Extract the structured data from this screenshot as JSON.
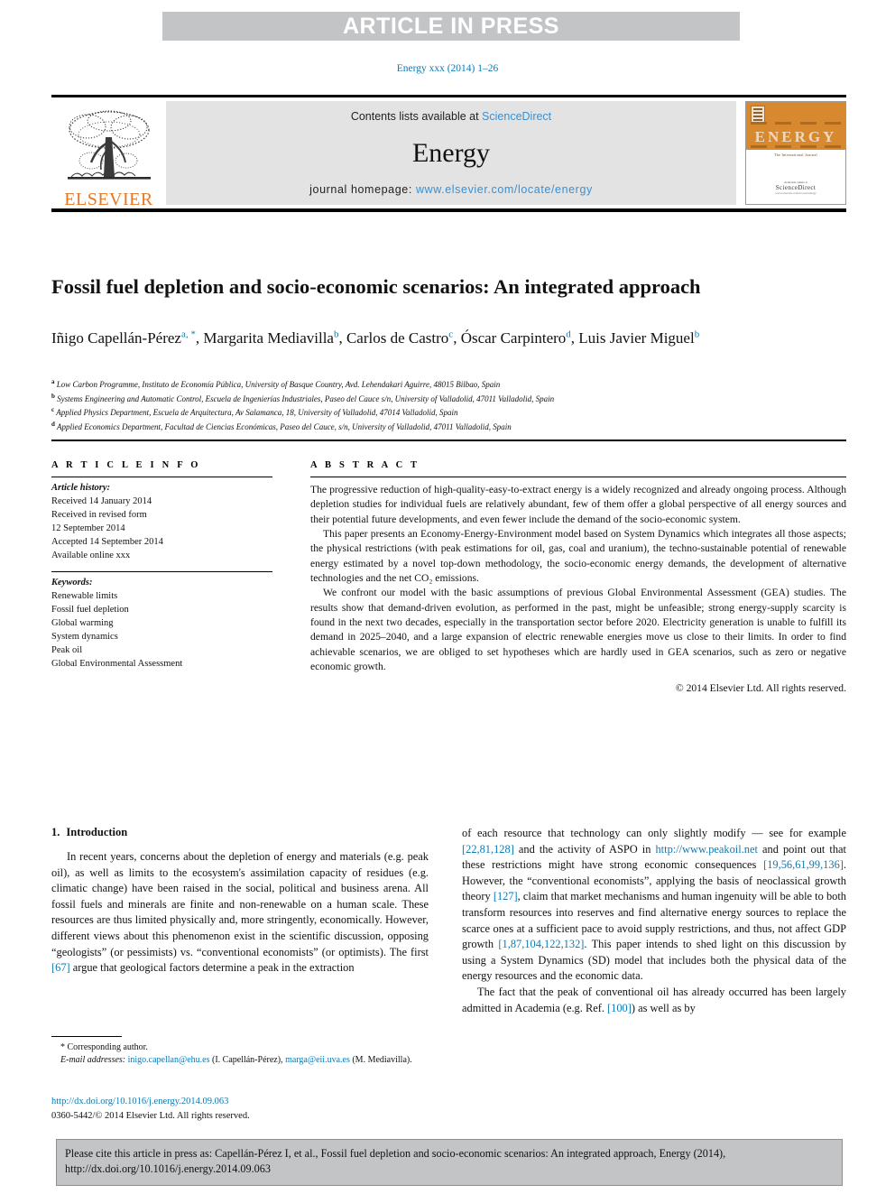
{
  "banner": {
    "label": "ARTICLE IN PRESS"
  },
  "journal_ref": "Energy xxx (2014) 1–26",
  "masthead": {
    "publisher": "ELSEVIER",
    "contents_prefix": "Contents lists available at ",
    "contents_link": "ScienceDirect",
    "journal_name": "Energy",
    "homepage_prefix": "journal homepage: ",
    "homepage_url": "www.elsevier.com/locate/energy",
    "cover": {
      "title": "ENERGY",
      "subtitle": "The International Journal",
      "footer_top": "Available online at",
      "footer_mid": "ScienceDirect",
      "footer_bottom": "www.elsevier.com/locate/energy"
    }
  },
  "article": {
    "title": "Fossil fuel depletion and socio-economic scenarios: An integrated approach",
    "authors": [
      {
        "name": "Iñigo Capellán-Pérez",
        "marks": "a, *"
      },
      {
        "name": "Margarita Mediavilla",
        "marks": "b"
      },
      {
        "name": "Carlos de Castro",
        "marks": "c"
      },
      {
        "name": "Óscar Carpintero",
        "marks": "d"
      },
      {
        "name": "Luis Javier Miguel",
        "marks": "b"
      }
    ],
    "affiliations": [
      {
        "mark": "a",
        "text": "Low Carbon Programme, Instituto de Economía Pública, University of Basque Country, Avd. Lehendakari Aguirre, 48015 Bilbao, Spain"
      },
      {
        "mark": "b",
        "text": "Systems Engineering and Automatic Control, Escuela de Ingenierías Industriales, Paseo del Cauce s/n, University of Valladolid, 47011 Valladolid, Spain"
      },
      {
        "mark": "c",
        "text": "Applied Physics Department, Escuela de Arquitectura, Av Salamanca, 18, University of Valladolid, 47014 Valladolid, Spain"
      },
      {
        "mark": "d",
        "text": "Applied Economics Department, Facultad de Ciencias Económicas, Paseo del Cauce, s/n, University of Valladolid, 47011 Valladolid, Spain"
      }
    ]
  },
  "info": {
    "heading": "A R T I C L E   I N F O",
    "history_label": "Article history:",
    "history": [
      "Received 14 January 2014",
      "Received in revised form",
      "12 September 2014",
      "Accepted 14 September 2014",
      "Available online xxx"
    ],
    "keywords_label": "Keywords:",
    "keywords": [
      "Renewable limits",
      "Fossil fuel depletion",
      "Global warming",
      "System dynamics",
      "Peak oil",
      "Global Environmental Assessment"
    ]
  },
  "abstract": {
    "heading": "A B S T R A C T",
    "paragraphs": [
      "The progressive reduction of high-quality-easy-to-extract energy is a widely recognized and already ongoing process. Although depletion studies for individual fuels are relatively abundant, few of them offer a global perspective of all energy sources and their potential future developments, and even fewer include the demand of the socio-economic system.",
      "This paper presents an Economy-Energy-Environment model based on System Dynamics which integrates all those aspects; the physical restrictions (with peak estimations for oil, gas, coal and uranium), the techno-sustainable potential of renewable energy estimated by a novel top-down methodology, the socio-economic energy demands, the development of alternative technologies and the net CO₂ emissions.",
      "We confront our model with the basic assumptions of previous Global Environmental Assessment (GEA) studies. The results show that demand-driven evolution, as performed in the past, might be unfeasible; strong energy-supply scarcity is found in the next two decades, especially in the transportation sector before 2020. Electricity generation is unable to fulfill its demand in 2025–2040, and a large expansion of electric renewable energies move us close to their limits. In order to find achievable scenarios, we are obliged to set hypotheses which are hardly used in GEA scenarios, such as zero or negative economic growth."
    ],
    "copyright": "© 2014 Elsevier Ltd. All rights reserved."
  },
  "intro": {
    "number": "1.",
    "heading": "Introduction",
    "left_paragraph": "In recent years, concerns about the depletion of energy and materials (e.g. peak oil), as well as limits to the ecosystem's assimilation capacity of residues (e.g. climatic change) have been raised in the social, political and business arena. All fossil fuels and minerals are finite and non-renewable on a human scale. These resources are thus limited physically and, more stringently, economically. However, different views about this phenomenon exist in the scientific discussion, opposing “geologists” (or pessimists) vs. “conventional economists” (or optimists). The first ",
    "left_ref1": "[67]",
    "left_tail": " argue that geological factors determine a peak in the extraction",
    "right_p1_a": "of each resource that technology can only slightly modify — see for example ",
    "right_ref1": "[22,81,128]",
    "right_p1_b": " and the activity of ASPO in ",
    "right_url1": "http://www.peakoil.net",
    "right_p1_c": " and point out that these restrictions might have strong economic consequences ",
    "right_ref2": "[19,56,61,99,136]",
    "right_p1_d": ". However, the “conventional economists”, applying the basis of neoclassical growth theory ",
    "right_ref3": "[127]",
    "right_p1_e": ", claim that market mechanisms and human ingenuity will be able to both transform resources into reserves and find alternative energy sources to replace the scarce ones at a sufficient pace to avoid supply restrictions, and thus, not affect GDP growth ",
    "right_ref4": "[1,87,104,122,132]",
    "right_p1_f": ". This paper intends to shed light on this discussion by using a System Dynamics (SD) model that includes both the physical data of the energy resources and the economic data.",
    "right_p2_a": "The fact that the peak of conventional oil has already occurred has been largely admitted in Academia (e.g. Ref. ",
    "right_ref5": "[100]",
    "right_p2_b": ") as well as by"
  },
  "footnote": {
    "star": "*",
    "corresponding": "Corresponding author.",
    "email_label": "E-mail addresses:",
    "email1": "inigo.capellan@ehu.es",
    "email1_owner": " (I. Capellán-Pérez), ",
    "email2": "marga@eii.uva.es",
    "email2_owner": "(M. Mediavilla).",
    "doi": "http://dx.doi.org/10.1016/j.energy.2014.09.063",
    "issn": "0360-5442/© 2014 Elsevier Ltd. All rights reserved."
  },
  "cite_box": {
    "text": "Please cite this article in press as: Capellán-Pérez I, et al., Fossil fuel depletion and socio-economic scenarios: An integrated approach, Energy (2014), http://dx.doi.org/10.1016/j.energy.2014.09.063"
  },
  "colors": {
    "banner_bg": "#c3c4c6",
    "link": "#0b7ab5",
    "sciencedirect": "#3b8fd0",
    "elsevier_orange": "#e77724",
    "masthead_bg": "#e3e3e3",
    "cover_orange": "#d8882e"
  }
}
